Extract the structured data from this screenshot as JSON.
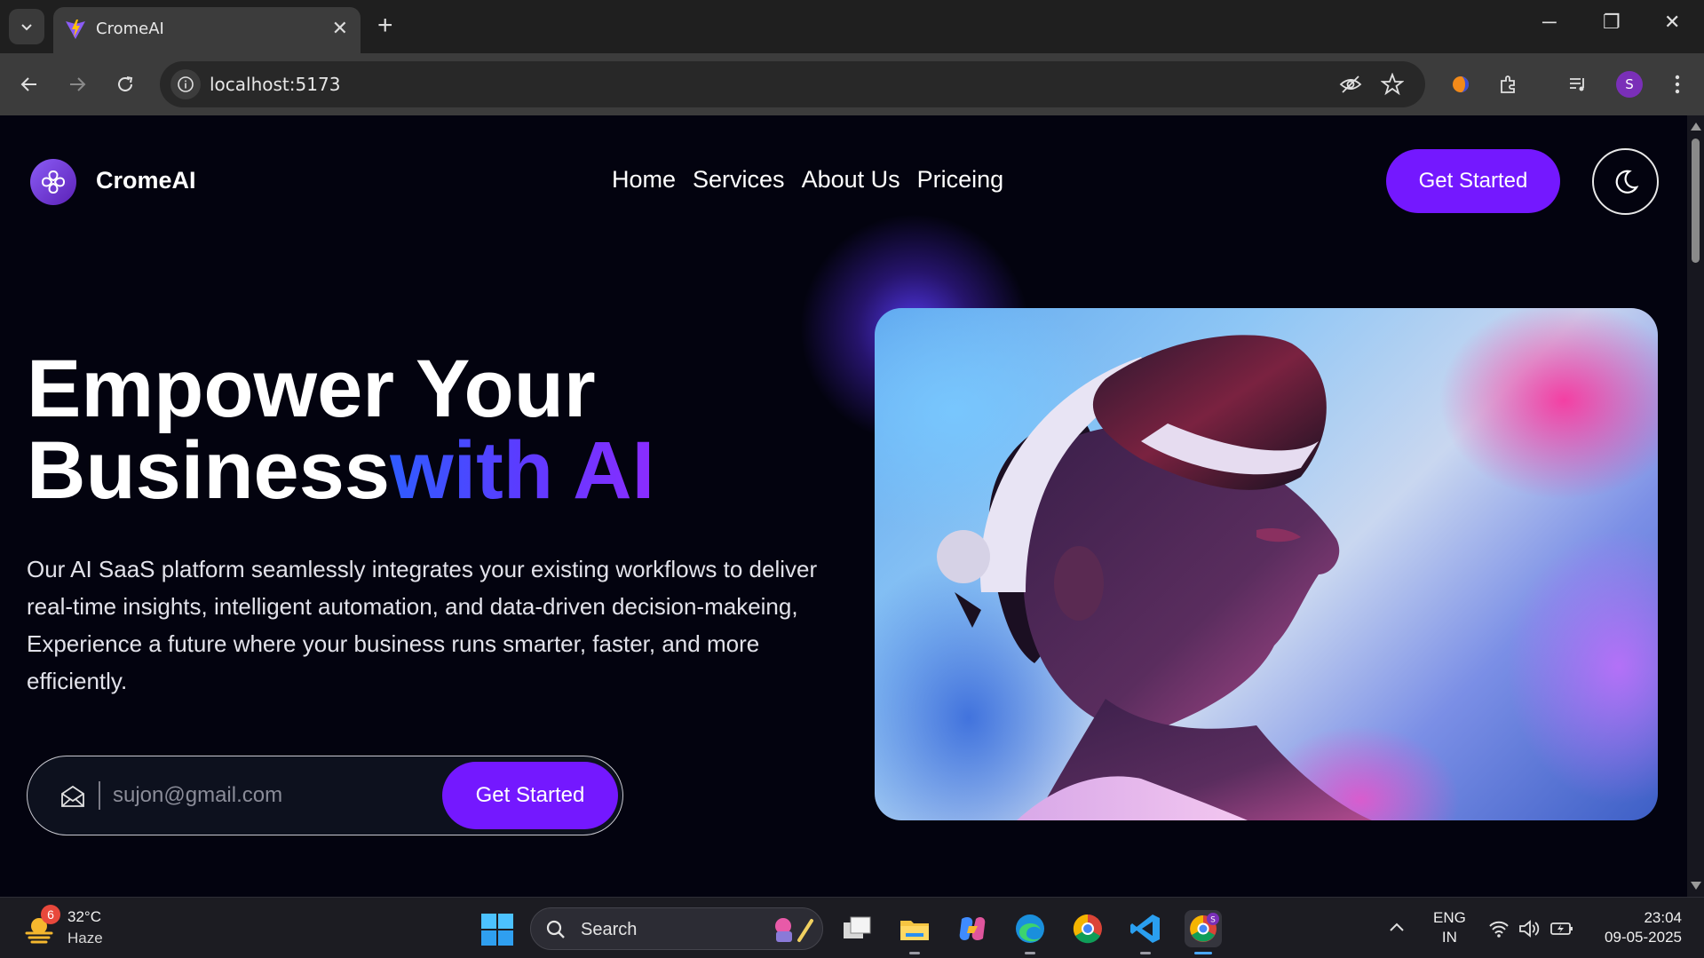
{
  "browser": {
    "tab_title": "CromeAI",
    "url": "localhost:5173"
  },
  "nav": {
    "brand": "CromeAI",
    "links": [
      "Home",
      "Services",
      "About Us",
      "Priceing"
    ],
    "cta": "Get Started"
  },
  "hero": {
    "heading_line1": "Empower Your",
    "heading_line2_plain": "Business",
    "heading_line2_accent": "with AI",
    "description": "Our AI SaaS platform seamlessly integrates your existing workflows to deliver real-time insights, intelligent automation, and data-driven decision-makeing, Experience a future where your business runs smarter, faster, and more efficiently.",
    "email_placeholder": "sujon@gmail.com",
    "form_cta": "Get Started",
    "image_icon": "vr-headset-person-image"
  },
  "taskbar": {
    "weather_badge": "6",
    "temperature": "32°C",
    "condition": "Haze",
    "search_label": "Search",
    "lang_line1": "ENG",
    "lang_line2": "IN",
    "time": "23:04",
    "date": "09-05-2025"
  },
  "colors": {
    "accent": "#7418ff",
    "background": "#03030f"
  }
}
